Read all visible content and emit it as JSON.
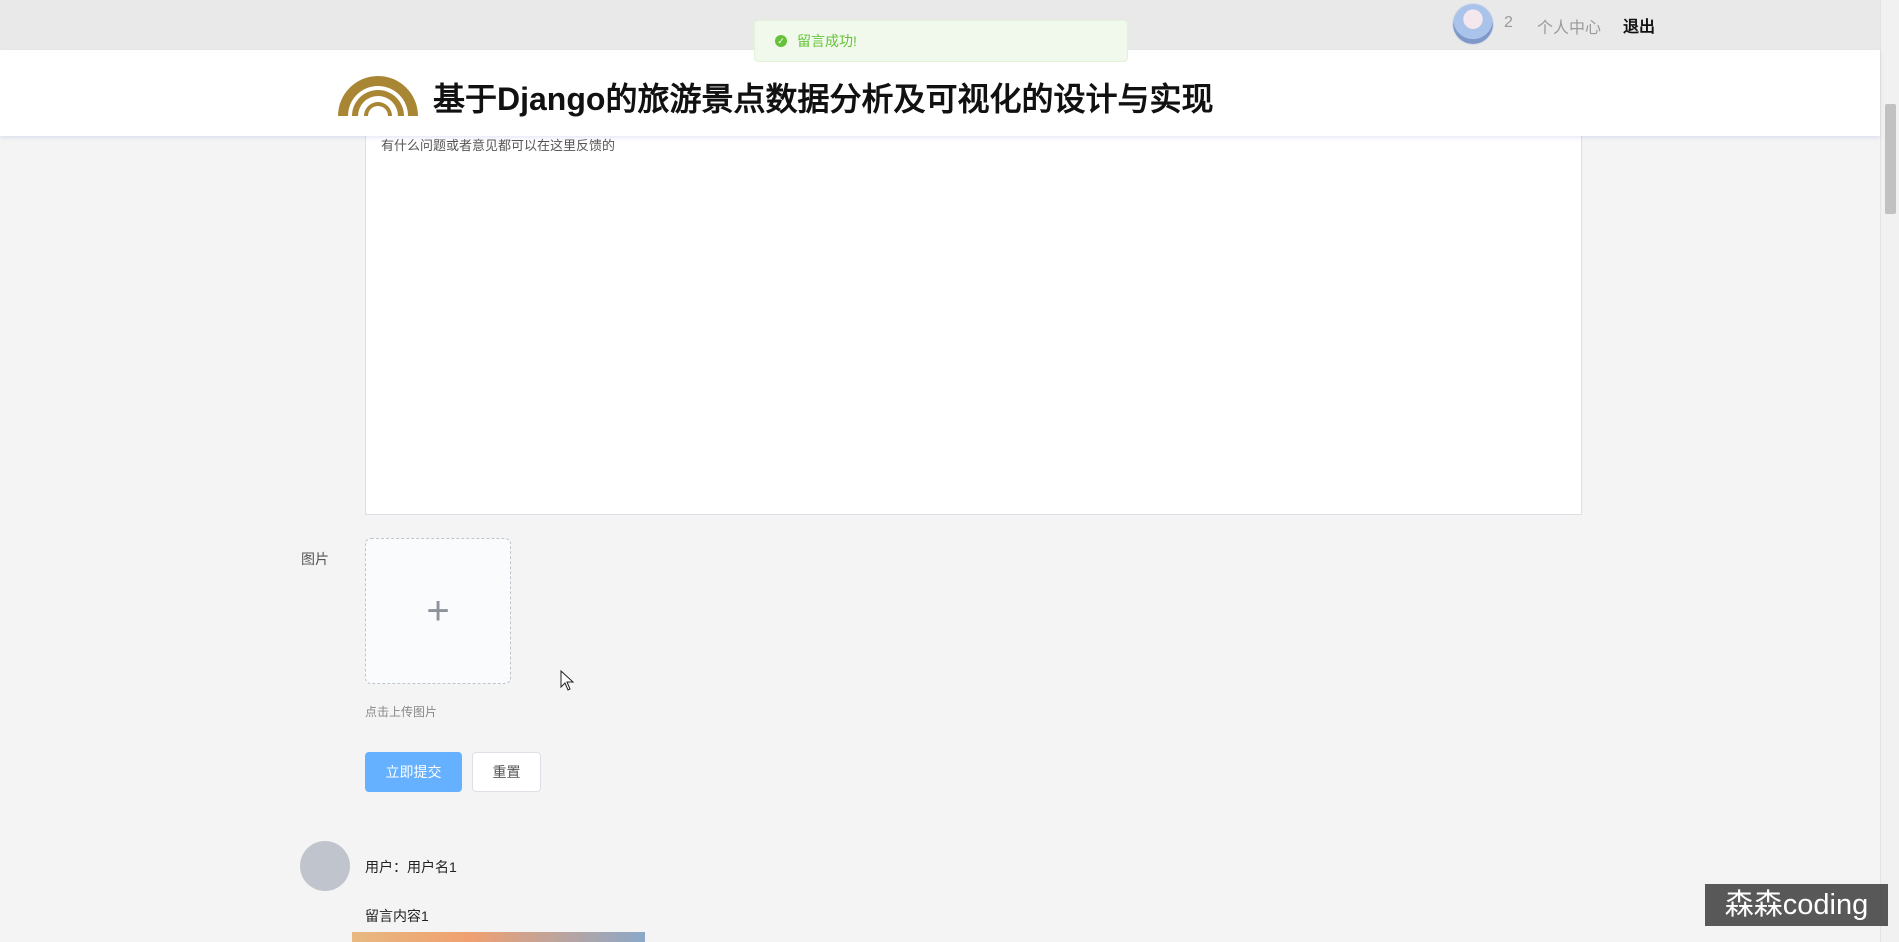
{
  "topbar": {
    "user_count": "2",
    "personal_center": "个人中心",
    "logout": "退出"
  },
  "toast": {
    "message": "留言成功!",
    "icon": "check-circle-icon",
    "color": "#67c23a"
  },
  "header": {
    "title": "基于Django的旅游景点数据分析及可视化的设计与实现",
    "logo_color": "#a98634"
  },
  "form": {
    "content_placeholder": "有什么问题或者意见都可以在这里反馈的",
    "image_label": "图片",
    "upload_hint": "点击上传图片",
    "submit_label": "立即提交",
    "reset_label": "重置",
    "primary_color": "#66b1ff"
  },
  "comments": [
    {
      "user_prefix": "用户：",
      "user_name": "用户名1",
      "content": "留言内容1"
    }
  ],
  "watermark": "森森coding"
}
